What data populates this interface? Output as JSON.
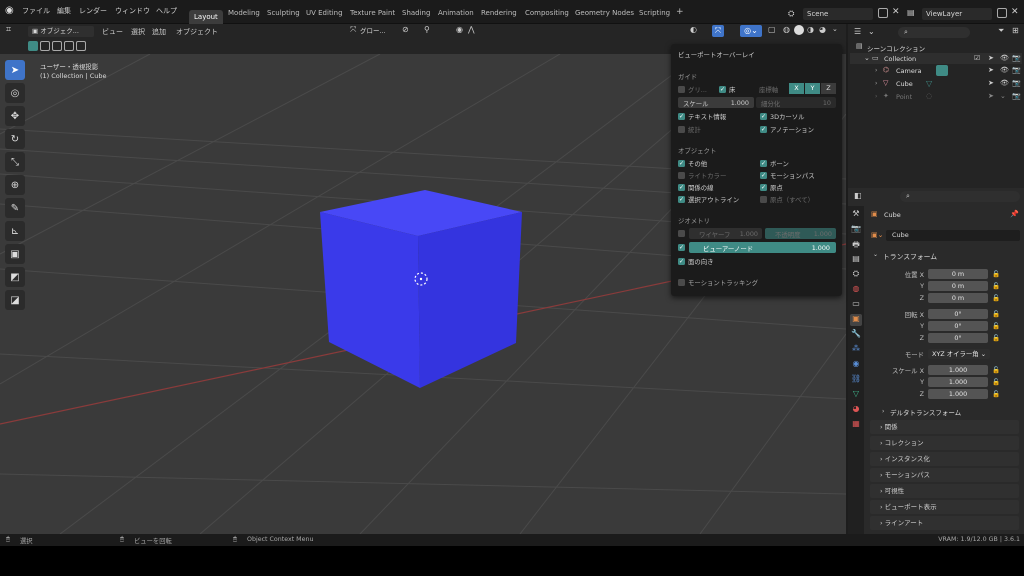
{
  "topbar": {
    "menus": [
      "ファイル",
      "編集",
      "レンダー",
      "ウィンドウ",
      "ヘルプ"
    ],
    "workspaces": [
      "Layout",
      "Modeling",
      "Sculpting",
      "UV Editing",
      "Texture Paint",
      "Shading",
      "Animation",
      "Rendering",
      "Compositing",
      "Geometry Nodes",
      "Scripting"
    ],
    "add_tab": "+",
    "scene": "Scene",
    "view_layer": "ViewLayer"
  },
  "viewport_header": {
    "mode": "オブジェク...",
    "menu": [
      "ビュー",
      "選択",
      "追加",
      "オブジェクト"
    ],
    "orientation": "グロー..."
  },
  "viewport": {
    "view_name": "ユーザー・透視投影",
    "collection_info": "(1) Collection | Cube"
  },
  "overlay": {
    "title": "ビューポートオーバーレイ",
    "guides": {
      "heading": "ガイド",
      "grid": "グリ...",
      "floor": "床",
      "axes": "座標軸",
      "x": "X",
      "y": "Y",
      "z": "Z",
      "scale_label": "スケール",
      "scale_value": "1.000",
      "subdivide": "細分化",
      "subdivide_value": "10",
      "text_info": "テキスト情報",
      "cursor_3d": "3Dカーソル",
      "stats": "統計",
      "annotation": "アノテーション"
    },
    "objects": {
      "heading": "オブジェクト",
      "extras": "その他",
      "bones": "ボーン",
      "light_colors": "ライトカラー",
      "motion_paths": "モーションパス",
      "relationship_lines": "関係の線",
      "origins": "原点",
      "outline_selected": "選択アウトライン",
      "origins_all": "原点（すべて）"
    },
    "geometry": {
      "heading": "ジオメトリ",
      "wireframe": "ワイヤーフ",
      "wireframe_value": "1.000",
      "opacity": "不透明度",
      "opacity_value": "1.000",
      "viewer_node": "ビューアーノード",
      "viewer_value": "1.000",
      "face_orientation": "面の向き"
    },
    "motion_tracking": "モーショントラッキング"
  },
  "outliner": {
    "title": "シーンコレクション",
    "items": [
      {
        "label": "Collection"
      },
      {
        "label": "Camera"
      },
      {
        "label": "Cube"
      },
      {
        "label": "Point"
      }
    ]
  },
  "properties": {
    "object_name": "Cube",
    "data_name": "Cube",
    "transform_heading": "トランスフォーム",
    "location_label": "位置 X",
    "location": [
      "0 m",
      "0 m",
      "0 m"
    ],
    "rotation_label": "回転 X",
    "rotation": [
      "0°",
      "0°",
      "0°"
    ],
    "axis_y": "Y",
    "axis_z": "Z",
    "mode_label": "モード",
    "mode_value": "XYZ オイラー角",
    "scale_label": "スケール X",
    "scale": [
      "1.000",
      "1.000",
      "1.000"
    ],
    "delta_transform": "デルタトランスフォーム",
    "panels": [
      "関係",
      "コレクション",
      "インスタンス化",
      "モーションパス",
      "可視性",
      "ビューポート表示",
      "ラインアート"
    ]
  },
  "statusbar": {
    "select": "選択",
    "rotate_view": "ビューを回転",
    "context_menu": "Object Context Menu",
    "vram": "VRAM: 1.9/12.0 GB | 3.6.1"
  },
  "colors": {
    "accent": "#3f74c9",
    "checkbox_teal": "#3f8b85",
    "cube": "#3b3be9"
  }
}
